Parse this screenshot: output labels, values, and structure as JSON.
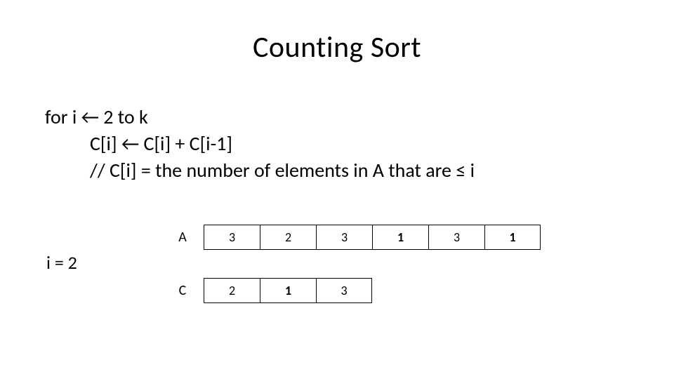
{
  "title": "Counting Sort",
  "code": {
    "line1": "for i ← 2 to k",
    "line2": "C[i] ← C[i] + C[i-1]",
    "line3": "// C[i] = the number of elements in A that are ≤ i"
  },
  "iter_label": "i = 2",
  "arrays": {
    "A": {
      "label": "A",
      "cells": [
        {
          "value": "3",
          "bold": false
        },
        {
          "value": "2",
          "bold": false
        },
        {
          "value": "3",
          "bold": false
        },
        {
          "value": "1",
          "bold": true
        },
        {
          "value": "3",
          "bold": false
        },
        {
          "value": "1",
          "bold": true
        }
      ]
    },
    "C": {
      "label": "C",
      "cells": [
        {
          "value": "2",
          "bold": false
        },
        {
          "value": "1",
          "bold": true
        },
        {
          "value": "3",
          "bold": false
        }
      ]
    }
  },
  "chart_data": {
    "type": "table",
    "title": "Counting Sort arrays at i = 2",
    "tables": [
      {
        "name": "A",
        "values": [
          3,
          2,
          3,
          1,
          3,
          1
        ]
      },
      {
        "name": "C",
        "values": [
          2,
          1,
          3
        ]
      }
    ]
  }
}
